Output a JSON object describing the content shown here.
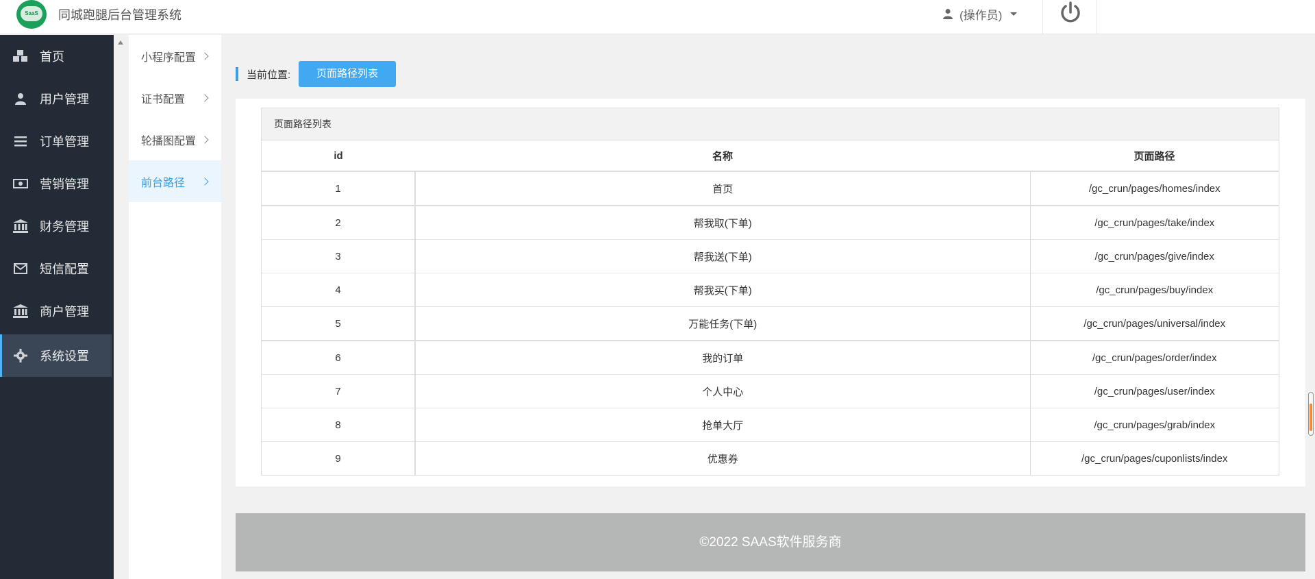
{
  "header": {
    "logo_text": "SaaS",
    "title": "同城跑腿后台管理系统",
    "user_label": "(操作员)"
  },
  "sidebar": {
    "items": [
      {
        "label": "首页",
        "icon": "cubes-icon"
      },
      {
        "label": "用户管理",
        "icon": "user-icon"
      },
      {
        "label": "订单管理",
        "icon": "list-icon"
      },
      {
        "label": "营销管理",
        "icon": "money-icon"
      },
      {
        "label": "财务管理",
        "icon": "bank-icon"
      },
      {
        "label": "短信配置",
        "icon": "envelope-icon"
      },
      {
        "label": "商户管理",
        "icon": "bank-icon"
      },
      {
        "label": "系统设置",
        "icon": "gear-icon",
        "active": true
      }
    ]
  },
  "submenu": {
    "items": [
      {
        "label": "小程序配置"
      },
      {
        "label": "证书配置"
      },
      {
        "label": "轮播图配置"
      },
      {
        "label": "前台路径",
        "active": true
      }
    ]
  },
  "breadcrumb": {
    "label": "当前位置:",
    "current": "页面路径列表"
  },
  "table": {
    "caption": "页面路径列表",
    "headers": [
      "id",
      "名称",
      "页面路径"
    ],
    "rows": [
      [
        "1",
        "首页",
        "/gc_crun/pages/homes/index"
      ],
      [
        "2",
        "帮我取(下单)",
        "/gc_crun/pages/take/index"
      ],
      [
        "3",
        "帮我送(下单)",
        "/gc_crun/pages/give/index"
      ],
      [
        "4",
        "帮我买(下单)",
        "/gc_crun/pages/buy/index"
      ],
      [
        "5",
        "万能任务(下单)",
        "/gc_crun/pages/universal/index"
      ],
      [
        "6",
        "我的订单",
        "/gc_crun/pages/order/index"
      ],
      [
        "7",
        "个人中心",
        "/gc_crun/pages/user/index"
      ],
      [
        "8",
        "抢单大厅",
        "/gc_crun/pages/grab/index"
      ],
      [
        "9",
        "优惠券",
        "/gc_crun/pages/cuponlists/index"
      ]
    ]
  },
  "footer": {
    "text": "©2022 SAAS软件服务商"
  },
  "colors": {
    "sidebar_bg": "#232c36",
    "accent": "#42a8f1",
    "footer_bg": "#b5b6b6"
  }
}
